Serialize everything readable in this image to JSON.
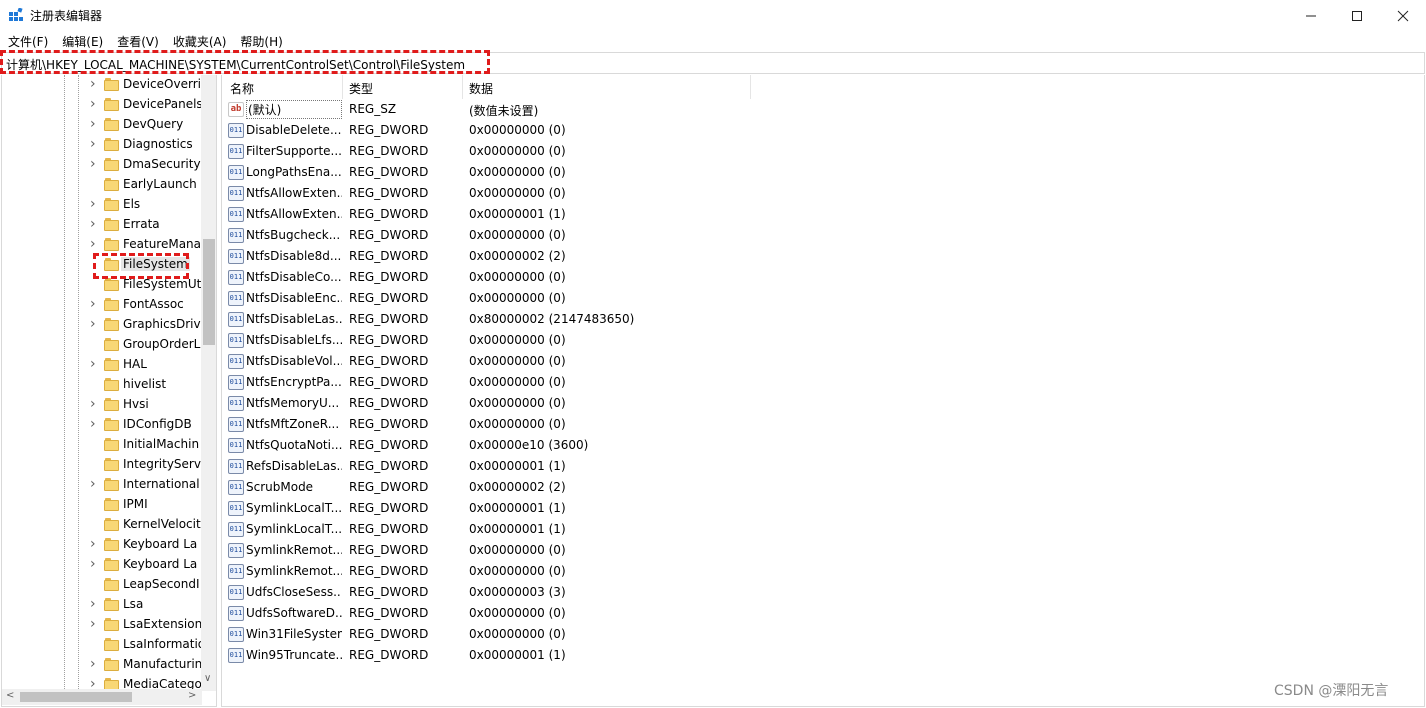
{
  "window": {
    "title": "注册表编辑器",
    "minimize_icon": "minimize-icon",
    "maximize_icon": "maximize-icon",
    "close_icon": "close-icon"
  },
  "menu": [
    "文件(F)",
    "编辑(E)",
    "查看(V)",
    "收藏夹(A)",
    "帮助(H)"
  ],
  "address": {
    "path": "计算机\\HKEY_LOCAL_MACHINE\\SYSTEM\\CurrentControlSet\\Control\\FileSystem"
  },
  "tree": {
    "items": [
      {
        "label": "DeviceOverri",
        "expandable": true
      },
      {
        "label": "DevicePanels",
        "expandable": true
      },
      {
        "label": "DevQuery",
        "expandable": true
      },
      {
        "label": "Diagnostics",
        "expandable": true
      },
      {
        "label": "DmaSecurity",
        "expandable": true
      },
      {
        "label": "EarlyLaunch",
        "expandable": false
      },
      {
        "label": "Els",
        "expandable": true
      },
      {
        "label": "Errata",
        "expandable": true
      },
      {
        "label": "FeatureMana",
        "expandable": true
      },
      {
        "label": "FileSystem",
        "expandable": false,
        "selected": true
      },
      {
        "label": "FileSystemUti",
        "expandable": false
      },
      {
        "label": "FontAssoc",
        "expandable": true
      },
      {
        "label": "GraphicsDriv",
        "expandable": true
      },
      {
        "label": "GroupOrderL",
        "expandable": false
      },
      {
        "label": "HAL",
        "expandable": true
      },
      {
        "label": "hivelist",
        "expandable": false
      },
      {
        "label": "Hvsi",
        "expandable": true
      },
      {
        "label": "IDConfigDB",
        "expandable": true
      },
      {
        "label": "InitialMachin",
        "expandable": false
      },
      {
        "label": "IntegrityServi",
        "expandable": false
      },
      {
        "label": "International",
        "expandable": true
      },
      {
        "label": "IPMI",
        "expandable": false
      },
      {
        "label": "KernelVelocit",
        "expandable": false
      },
      {
        "label": "Keyboard La",
        "expandable": true
      },
      {
        "label": "Keyboard La",
        "expandable": true
      },
      {
        "label": "LeapSecondI",
        "expandable": false
      },
      {
        "label": "Lsa",
        "expandable": true
      },
      {
        "label": "LsaExtension",
        "expandable": true
      },
      {
        "label": "LsaInformatio",
        "expandable": false
      },
      {
        "label": "Manufacturin",
        "expandable": true
      },
      {
        "label": "MediaCatego",
        "expandable": true
      }
    ]
  },
  "list": {
    "headers": {
      "name": "名称",
      "type": "类型",
      "data": "数据"
    },
    "rows": [
      {
        "name": "(默认)",
        "type": "REG_SZ",
        "data": "(数值未设置)",
        "icon": "ab"
      },
      {
        "name": "DisableDelete...",
        "type": "REG_DWORD",
        "data": "0x00000000 (0)",
        "icon": "011"
      },
      {
        "name": "FilterSupporte...",
        "type": "REG_DWORD",
        "data": "0x00000000 (0)",
        "icon": "011"
      },
      {
        "name": "LongPathsEna...",
        "type": "REG_DWORD",
        "data": "0x00000000 (0)",
        "icon": "011"
      },
      {
        "name": "NtfsAllowExten...",
        "type": "REG_DWORD",
        "data": "0x00000000 (0)",
        "icon": "011"
      },
      {
        "name": "NtfsAllowExten...",
        "type": "REG_DWORD",
        "data": "0x00000001 (1)",
        "icon": "011"
      },
      {
        "name": "NtfsBugcheck...",
        "type": "REG_DWORD",
        "data": "0x00000000 (0)",
        "icon": "011"
      },
      {
        "name": "NtfsDisable8d...",
        "type": "REG_DWORD",
        "data": "0x00000002 (2)",
        "icon": "011"
      },
      {
        "name": "NtfsDisableCo...",
        "type": "REG_DWORD",
        "data": "0x00000000 (0)",
        "icon": "011"
      },
      {
        "name": "NtfsDisableEnc...",
        "type": "REG_DWORD",
        "data": "0x00000000 (0)",
        "icon": "011"
      },
      {
        "name": "NtfsDisableLas...",
        "type": "REG_DWORD",
        "data": "0x80000002 (2147483650)",
        "icon": "011"
      },
      {
        "name": "NtfsDisableLfs...",
        "type": "REG_DWORD",
        "data": "0x00000000 (0)",
        "icon": "011"
      },
      {
        "name": "NtfsDisableVol...",
        "type": "REG_DWORD",
        "data": "0x00000000 (0)",
        "icon": "011"
      },
      {
        "name": "NtfsEncryptPa...",
        "type": "REG_DWORD",
        "data": "0x00000000 (0)",
        "icon": "011"
      },
      {
        "name": "NtfsMemoryU...",
        "type": "REG_DWORD",
        "data": "0x00000000 (0)",
        "icon": "011"
      },
      {
        "name": "NtfsMftZoneR...",
        "type": "REG_DWORD",
        "data": "0x00000000 (0)",
        "icon": "011"
      },
      {
        "name": "NtfsQuotaNoti...",
        "type": "REG_DWORD",
        "data": "0x00000e10 (3600)",
        "icon": "011"
      },
      {
        "name": "RefsDisableLas...",
        "type": "REG_DWORD",
        "data": "0x00000001 (1)",
        "icon": "011"
      },
      {
        "name": "ScrubMode",
        "type": "REG_DWORD",
        "data": "0x00000002 (2)",
        "icon": "011"
      },
      {
        "name": "SymlinkLocalT...",
        "type": "REG_DWORD",
        "data": "0x00000001 (1)",
        "icon": "011"
      },
      {
        "name": "SymlinkLocalT...",
        "type": "REG_DWORD",
        "data": "0x00000001 (1)",
        "icon": "011"
      },
      {
        "name": "SymlinkRemot...",
        "type": "REG_DWORD",
        "data": "0x00000000 (0)",
        "icon": "011"
      },
      {
        "name": "SymlinkRemot...",
        "type": "REG_DWORD",
        "data": "0x00000000 (0)",
        "icon": "011"
      },
      {
        "name": "UdfsCloseSess...",
        "type": "REG_DWORD",
        "data": "0x00000003 (3)",
        "icon": "011"
      },
      {
        "name": "UdfsSoftwareD...",
        "type": "REG_DWORD",
        "data": "0x00000000 (0)",
        "icon": "011"
      },
      {
        "name": "Win31FileSystem",
        "type": "REG_DWORD",
        "data": "0x00000000 (0)",
        "icon": "011"
      },
      {
        "name": "Win95Truncate...",
        "type": "REG_DWORD",
        "data": "0x00000001 (1)",
        "icon": "011"
      }
    ]
  },
  "watermark": "CSDN @溧阳无言",
  "colors": {
    "highlight": "#e01b1b",
    "folder": "#f8d775"
  }
}
